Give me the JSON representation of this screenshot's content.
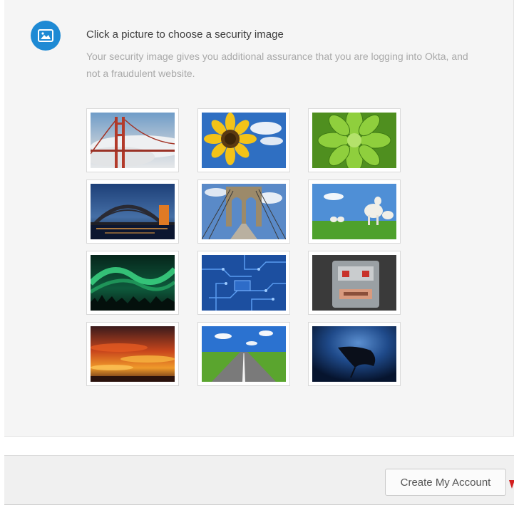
{
  "header": {
    "icon": "image-icon",
    "accent_color": "#1e8ad4",
    "title": "Click a picture to choose a security image",
    "subtitle": "Your security image gives you additional assurance that you are logging into Okta, and not a fraudulent website."
  },
  "images": [
    {
      "subject": "golden-gate-bridge-fog"
    },
    {
      "subject": "sunflower"
    },
    {
      "subject": "green-succulent"
    },
    {
      "subject": "harbour-bridge-dusk"
    },
    {
      "subject": "brooklyn-bridge"
    },
    {
      "subject": "lambs-on-grass"
    },
    {
      "subject": "aurora-borealis"
    },
    {
      "subject": "blue-circuit-board"
    },
    {
      "subject": "robot-toy-face"
    },
    {
      "subject": "orange-sunset-clouds"
    },
    {
      "subject": "open-road"
    },
    {
      "subject": "manta-ray-underwater"
    }
  ],
  "footer": {
    "create_button": "Create My Account"
  }
}
